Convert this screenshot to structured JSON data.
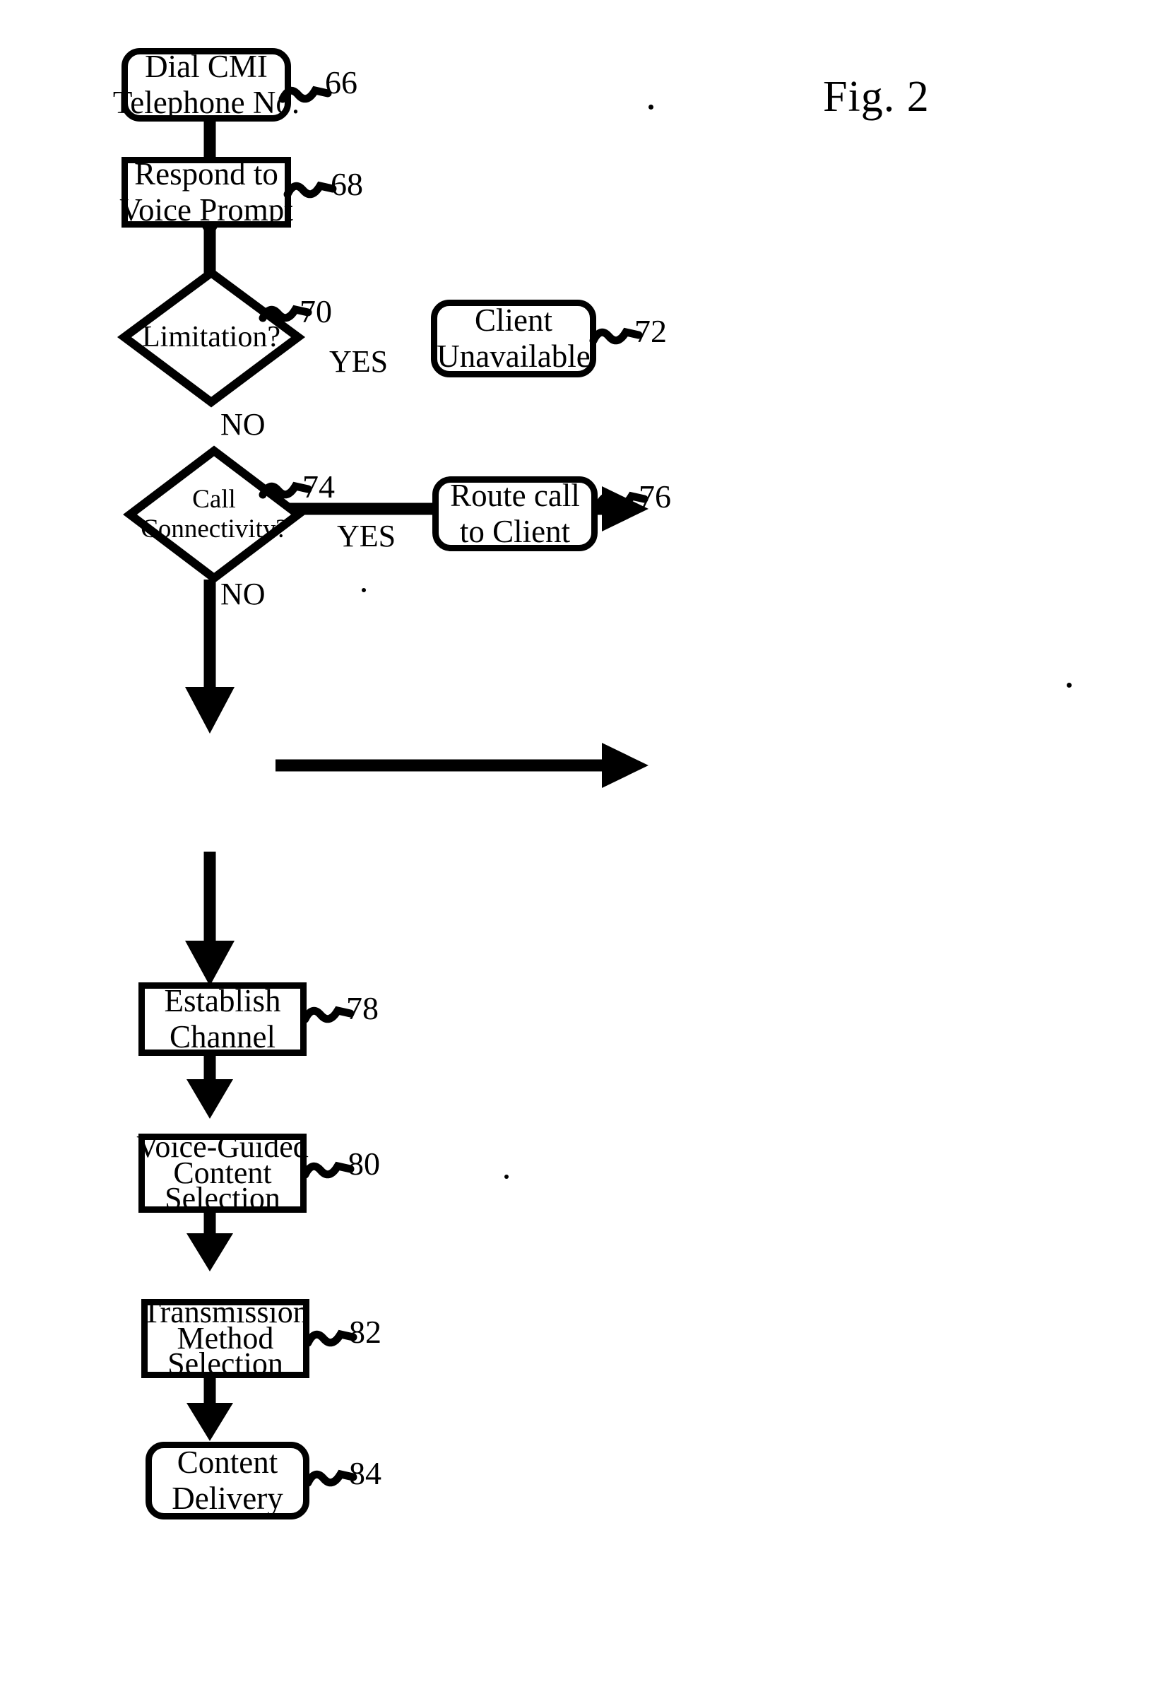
{
  "figure": {
    "title": "Fig. 2",
    "type": "patent-flowchart"
  },
  "chart_data": {
    "type": "diagram",
    "title": "Fig. 2",
    "nodes": [
      {
        "id": "66",
        "shape": "rounded-rect",
        "lines": [
          "Dial CMI",
          "Telephone No."
        ],
        "ref": "66"
      },
      {
        "id": "68",
        "shape": "rect",
        "lines": [
          "Respond to",
          "Voice Prompt"
        ],
        "ref": "68"
      },
      {
        "id": "70",
        "shape": "diamond",
        "lines": [
          "Limitation?"
        ],
        "ref": "70"
      },
      {
        "id": "72",
        "shape": "rounded-rect",
        "lines": [
          "Client",
          "Unavailable"
        ],
        "ref": "72"
      },
      {
        "id": "74",
        "shape": "diamond",
        "lines": [
          "Call",
          "Connectivity?"
        ],
        "ref": "74"
      },
      {
        "id": "76",
        "shape": "rounded-rect",
        "lines": [
          "Route call",
          "to Client"
        ],
        "ref": "76"
      },
      {
        "id": "78",
        "shape": "rect",
        "lines": [
          "Establish",
          "Channel"
        ],
        "ref": "78"
      },
      {
        "id": "80",
        "shape": "rect",
        "lines": [
          "Voice-Guided",
          "Content",
          "Selection"
        ],
        "ref": "80"
      },
      {
        "id": "82",
        "shape": "rect",
        "lines": [
          "Transmission",
          "Method",
          "Selection"
        ],
        "ref": "82"
      },
      {
        "id": "84",
        "shape": "rounded-rect",
        "lines": [
          "Content",
          "Delivery"
        ],
        "ref": "84"
      }
    ],
    "edges": [
      {
        "from": "66",
        "to": "68",
        "label": ""
      },
      {
        "from": "68",
        "to": "70",
        "label": ""
      },
      {
        "from": "70",
        "to": "72",
        "label": "YES"
      },
      {
        "from": "70",
        "to": "74",
        "label": "NO"
      },
      {
        "from": "74",
        "to": "76",
        "label": "YES"
      },
      {
        "from": "74",
        "to": "78",
        "label": "NO"
      },
      {
        "from": "78",
        "to": "80",
        "label": ""
      },
      {
        "from": "80",
        "to": "82",
        "label": ""
      },
      {
        "from": "82",
        "to": "84",
        "label": ""
      }
    ]
  },
  "nodes": {
    "dial": {
      "line1": "Dial CMI",
      "line2": "Telephone No.",
      "ref": "66"
    },
    "respond": {
      "line1": "Respond to",
      "line2": "Voice Prompt",
      "ref": "68"
    },
    "limitation": {
      "line1": "Limitation?",
      "ref": "70"
    },
    "client_unavailable": {
      "line1": "Client",
      "line2": "Unavailable",
      "ref": "72"
    },
    "call_connectivity": {
      "line1": "Call",
      "line2": "Connectivity?",
      "ref": "74"
    },
    "route_call": {
      "line1": "Route call",
      "line2": "to Client",
      "ref": "76"
    },
    "establish_channel": {
      "line1": "Establish",
      "line2": "Channel",
      "ref": "78"
    },
    "voice_guided": {
      "line1": "Voice-Guided",
      "line2": "Content",
      "line3": "Selection",
      "ref": "80"
    },
    "transmission": {
      "line1": "Transmission",
      "line2": "Method",
      "line3": "Selection",
      "ref": "82"
    },
    "content_delivery": {
      "line1": "Content",
      "line2": "Delivery",
      "ref": "84"
    }
  },
  "branch_labels": {
    "limitation_yes": "YES",
    "limitation_no": "NO",
    "connectivity_yes": "YES",
    "connectivity_no": "NO"
  },
  "colors": {
    "ink": "#000000",
    "paper": "#ffffff"
  }
}
